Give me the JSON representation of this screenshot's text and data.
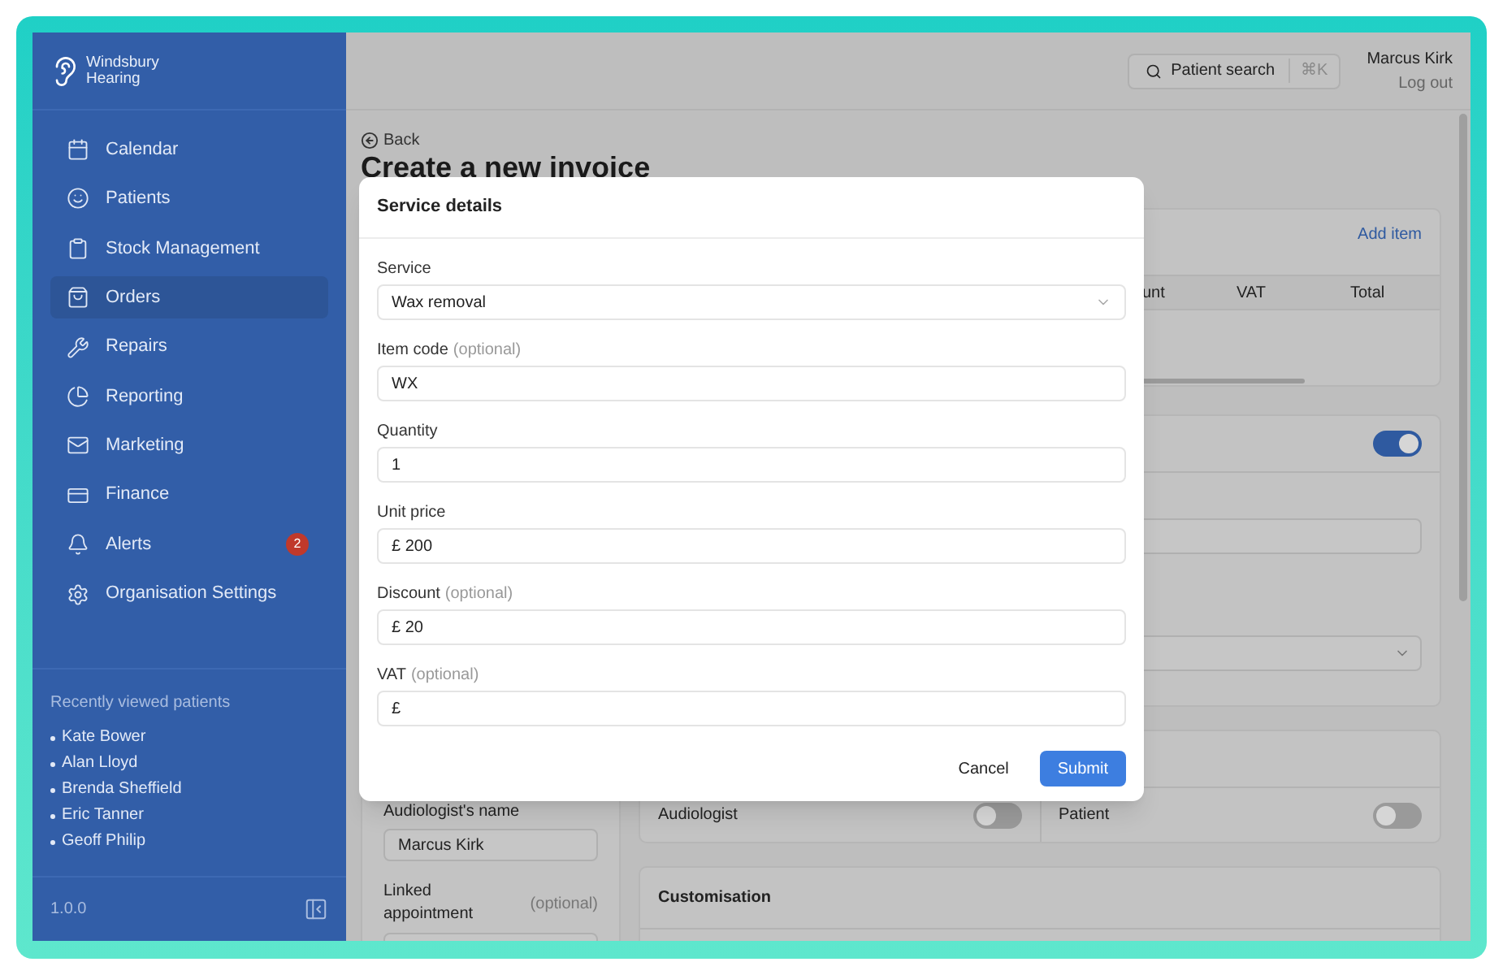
{
  "brand": "Windsbury Hearing",
  "nav": [
    {
      "label": "Calendar",
      "selected": false
    },
    {
      "label": "Patients",
      "selected": false
    },
    {
      "label": "Stock Management",
      "selected": false
    },
    {
      "label": "Orders",
      "selected": true
    },
    {
      "label": "Repairs",
      "selected": false
    },
    {
      "label": "Reporting",
      "selected": false
    },
    {
      "label": "Marketing",
      "selected": false
    },
    {
      "label": "Finance",
      "selected": false
    },
    {
      "label": "Alerts",
      "selected": false,
      "badge": "2"
    },
    {
      "label": "Organisation Settings",
      "selected": false
    }
  ],
  "recent": {
    "title": "Recently viewed patients",
    "patients": [
      "Kate Bower",
      "Alan Lloyd",
      "Brenda Sheffield",
      "Eric Tanner",
      "Geoff Philip"
    ]
  },
  "version": "1.0.0",
  "header": {
    "search": {
      "label": "Patient search",
      "shortcut": "⌘K"
    },
    "user": {
      "name": "Marcus Kirk",
      "logout": "Log out"
    }
  },
  "page": {
    "back": "Back",
    "title": "Create a new invoice",
    "items_card": {
      "add_item": "Add item",
      "columns": [
        "unt",
        "VAT",
        "Total"
      ]
    },
    "settings_card": {
      "on": true
    },
    "left_card": {
      "audiologist_label": "Audiologist's name",
      "audiologist_value": "Marcus Kirk",
      "appointment_label": "Linked appointment",
      "appointment_hint": "(optional)"
    },
    "notify_card": {
      "toggles": [
        {
          "label": "Audiologist",
          "on": false
        },
        {
          "label": "Patient",
          "on": false
        }
      ]
    },
    "customisation": {
      "title": "Customisation"
    }
  },
  "modal": {
    "title": "Service details",
    "fields": [
      {
        "label": "Service",
        "kind": "select",
        "value": "Wax removal"
      },
      {
        "label": "Item code",
        "hint": "(optional)",
        "kind": "text",
        "value": "WX"
      },
      {
        "label": "Quantity",
        "kind": "text",
        "value": "1"
      },
      {
        "label": "Unit price",
        "kind": "text",
        "value": "£ 200"
      },
      {
        "label": "Discount",
        "hint": "(optional)",
        "kind": "text",
        "value": "£ 20"
      },
      {
        "label": "VAT",
        "hint": "(optional)",
        "kind": "text",
        "value": "£"
      }
    ],
    "cancel": "Cancel",
    "submit": "Submit"
  }
}
